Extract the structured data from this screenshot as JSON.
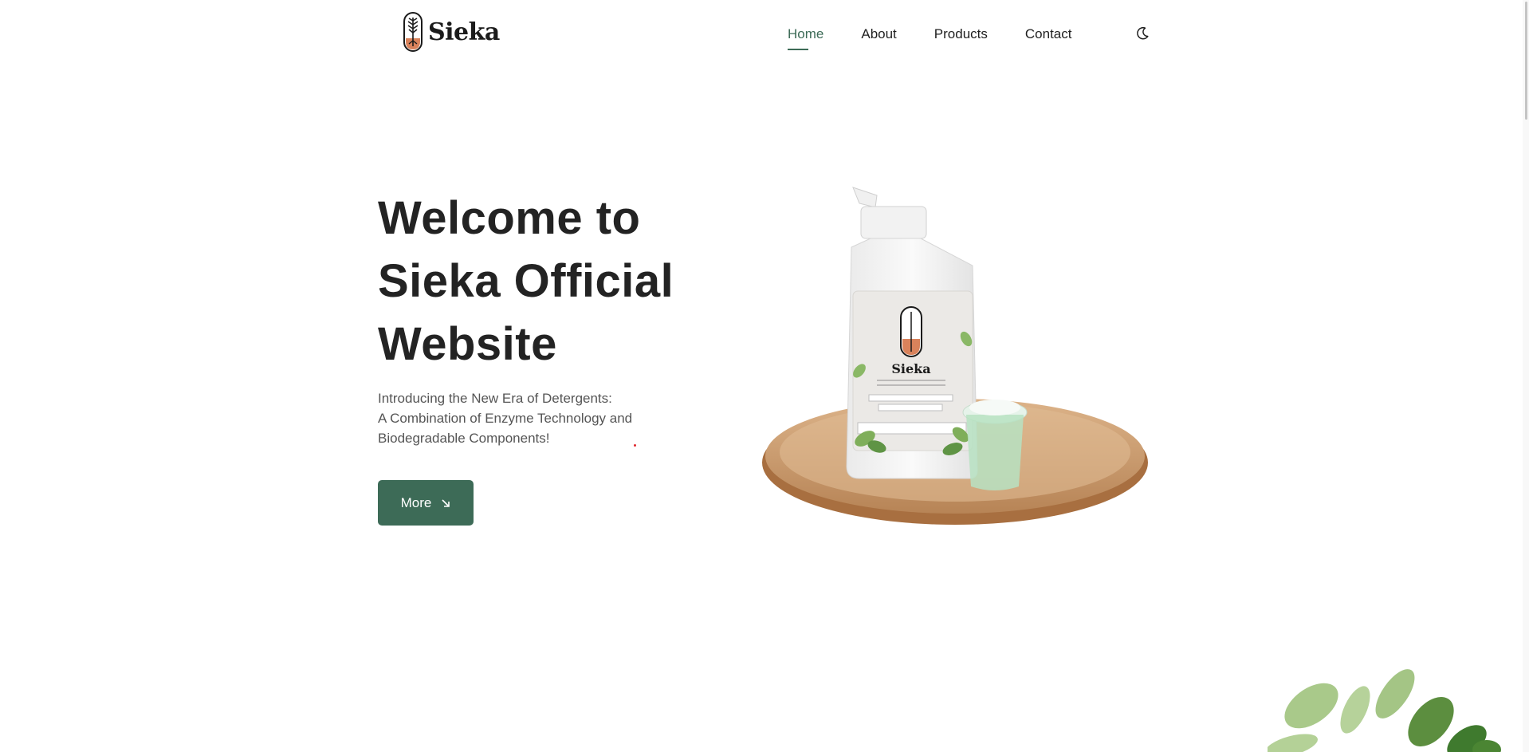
{
  "brand": {
    "name": "Sieka",
    "logo_icon": "plant-seal-icon"
  },
  "nav": {
    "items": [
      {
        "label": "Home",
        "active": true
      },
      {
        "label": "About",
        "active": false
      },
      {
        "label": "Products",
        "active": false
      },
      {
        "label": "Contact",
        "active": false
      }
    ],
    "theme_icon": "moon-icon"
  },
  "hero": {
    "title_lines": [
      "Welcome to",
      "Sieka Official",
      "Website"
    ],
    "description_lines": [
      "Introducing the New Era of Detergents:",
      "A Combination of Enzyme Technology and",
      "Biodegradable Components!"
    ],
    "button_label": "More",
    "button_icon": "arrow-down-right-icon",
    "bottle_label_brand": "Sieka"
  },
  "colors": {
    "accent": "#3d6b57",
    "text_dark": "#232323",
    "text_body": "#555555",
    "background": "#ffffff"
  }
}
